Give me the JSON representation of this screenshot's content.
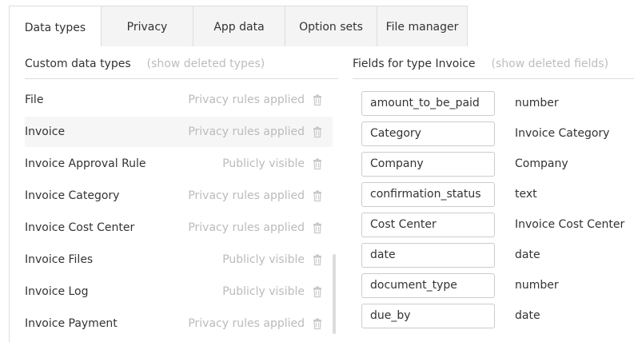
{
  "tabs": [
    {
      "label": "Data types",
      "active": true
    },
    {
      "label": "Privacy"
    },
    {
      "label": "App data"
    },
    {
      "label": "Option sets"
    },
    {
      "label": "File manager"
    }
  ],
  "left": {
    "title": "Custom data types",
    "show_deleted": "(show deleted types)",
    "types": [
      {
        "name": "File",
        "status": "Privacy rules applied"
      },
      {
        "name": "Invoice",
        "status": "Privacy rules applied",
        "selected": true
      },
      {
        "name": "Invoice Approval Rule",
        "status": "Publicly visible"
      },
      {
        "name": "Invoice Category",
        "status": "Privacy rules applied"
      },
      {
        "name": "Invoice Cost Center",
        "status": "Privacy rules applied"
      },
      {
        "name": "Invoice Files",
        "status": "Publicly visible"
      },
      {
        "name": "Invoice Log",
        "status": "Publicly visible"
      },
      {
        "name": "Invoice Payment",
        "status": "Privacy rules applied"
      }
    ]
  },
  "right": {
    "title": "Fields for type Invoice",
    "show_deleted": "(show deleted fields)",
    "fields": [
      {
        "name": "amount_to_be_paid",
        "type": "number"
      },
      {
        "name": "Category",
        "type": "Invoice Category"
      },
      {
        "name": "Company",
        "type": "Company"
      },
      {
        "name": "confirmation_status",
        "type": "text"
      },
      {
        "name": "Cost Center",
        "type": "Invoice Cost Center"
      },
      {
        "name": "date",
        "type": "date"
      },
      {
        "name": "document_type",
        "type": "number"
      },
      {
        "name": "due_by",
        "type": "date"
      }
    ]
  },
  "icons": {
    "delete": "trash-icon"
  }
}
